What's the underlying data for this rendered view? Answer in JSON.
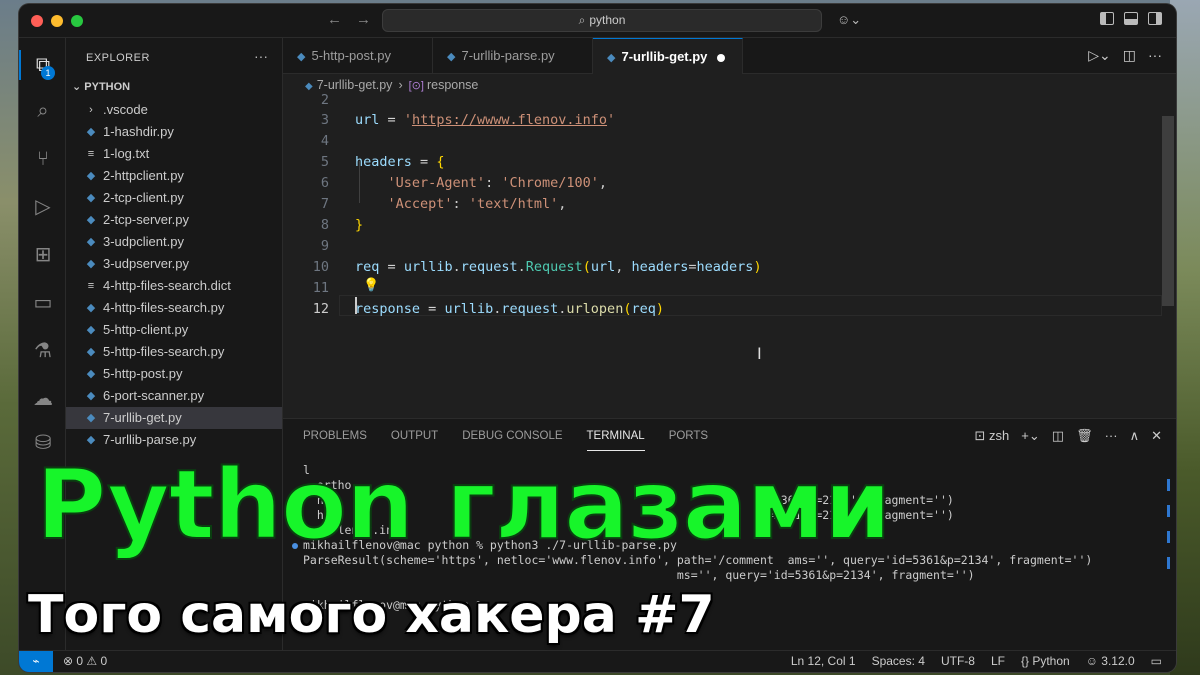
{
  "titlebar": {
    "search_text": "python"
  },
  "activity": {
    "explorer_badge": "1"
  },
  "sidebar": {
    "title": "EXPLORER",
    "folder": "PYTHON",
    "files": [
      {
        "name": ".vscode",
        "type": "folder"
      },
      {
        "name": "1-hashdir.py",
        "type": "py"
      },
      {
        "name": "1-log.txt",
        "type": "txt"
      },
      {
        "name": "2-httpclient.py",
        "type": "py"
      },
      {
        "name": "2-tcp-client.py",
        "type": "py"
      },
      {
        "name": "2-tcp-server.py",
        "type": "py"
      },
      {
        "name": "3-udpclient.py",
        "type": "py"
      },
      {
        "name": "3-udpserver.py",
        "type": "py"
      },
      {
        "name": "4-http-files-search.dict",
        "type": "txt"
      },
      {
        "name": "4-http-files-search.py",
        "type": "py"
      },
      {
        "name": "5-http-client.py",
        "type": "py"
      },
      {
        "name": "5-http-files-search.py",
        "type": "py"
      },
      {
        "name": "5-http-post.py",
        "type": "py"
      },
      {
        "name": "6-port-scanner.py",
        "type": "py"
      },
      {
        "name": "7-urllib-get.py",
        "type": "py",
        "selected": true
      },
      {
        "name": "7-urllib-parse.py",
        "type": "py"
      }
    ]
  },
  "tabs": [
    {
      "label": "5-http-post.py",
      "active": false
    },
    {
      "label": "7-urllib-parse.py",
      "active": false
    },
    {
      "label": "7-urllib-get.py",
      "active": true,
      "modified": true
    }
  ],
  "breadcrumb": {
    "file": "7-urllib-get.py",
    "symbol": "response"
  },
  "editor": {
    "line_numbers": [
      "2",
      "3",
      "4",
      "5",
      "6",
      "7",
      "8",
      "9",
      "10",
      "11",
      "12"
    ],
    "current_line": "12"
  },
  "panel": {
    "tabs": [
      "PROBLEMS",
      "OUTPUT",
      "DEBUG CONSOLE",
      "TERMINAL",
      "PORTS"
    ],
    "active_tab": "TERMINAL",
    "shell": "zsh",
    "terminal_lines": [
      "l",
      "  ortho",
      "  htt                                                            id=5361&p=2134', fragment='')",
      "  htt                                                            id=5361&p=2134', fragment='')",
      "www.flenov.info",
      "mikhailflenov@mac python % python3 ./7-urllib-parse.py",
      "ParseResult(scheme='https', netloc='www.flenov.info', path='/comment  ams='', query='id=5361&p=2134', fragment='')",
      "                                                      ms='', query='id=5361&p=2134', fragment='')",
      "",
      "mikhailflenov@mac python % "
    ]
  },
  "statusbar": {
    "errors": "0",
    "warnings": "0",
    "position": "Ln 12, Col 1",
    "spaces": "Spaces: 4",
    "encoding": "UTF-8",
    "eol": "LF",
    "language": "Python",
    "interpreter": "3.12.0"
  },
  "overlay": {
    "title": "Python глазами",
    "subtitle": "Того самого хакера #7"
  }
}
